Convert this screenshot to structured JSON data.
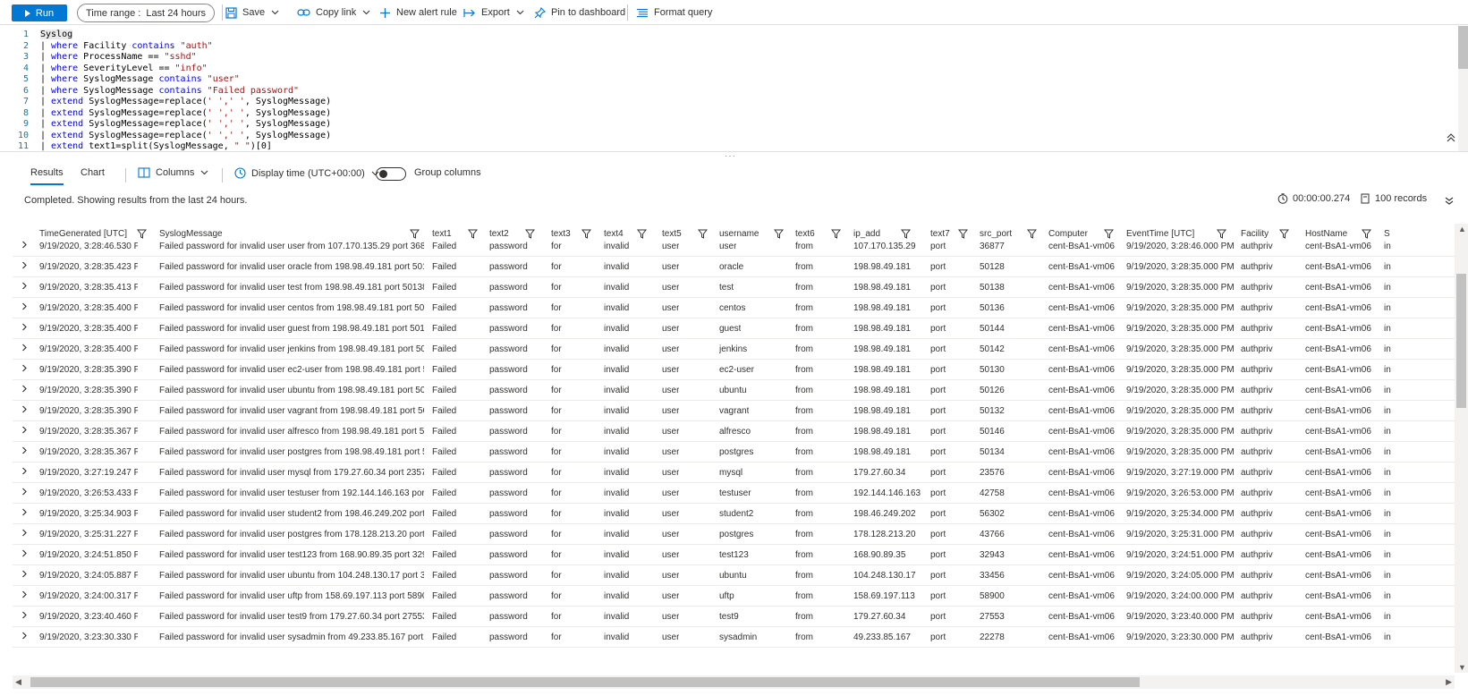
{
  "toolbar": {
    "run_label": "Run",
    "time_range_label": "Time range :",
    "time_range_value": "Last 24 hours",
    "save_label": "Save",
    "copy_link_label": "Copy link",
    "new_alert_label": "New alert rule",
    "export_label": "Export",
    "pin_label": "Pin to dashboard",
    "format_label": "Format query"
  },
  "editor": {
    "line_numbers": [
      "1",
      "2",
      "3",
      "4",
      "5",
      "6",
      "7",
      "8",
      "9",
      "10",
      "11"
    ]
  },
  "results_bar": {
    "tab_results": "Results",
    "tab_chart": "Chart",
    "columns_label": "Columns",
    "display_time_label": "Display time (UTC+00:00)",
    "group_columns_label": "Group columns"
  },
  "status": {
    "message": "Completed. Showing results from the last 24 hours.",
    "duration": "00:00:00.274",
    "records": "100 records"
  },
  "grid": {
    "headers": [
      "TimeGenerated [UTC]",
      "SyslogMessage",
      "text1",
      "text2",
      "text3",
      "text4",
      "text5",
      "username",
      "text6",
      "ip_add",
      "text7",
      "src_port",
      "Computer",
      "EventTime [UTC]",
      "Facility",
      "HostName",
      "S"
    ],
    "rows": [
      [
        "9/19/2020, 3:28:46.530 PM",
        "Failed password for invalid user user from 107.170.135.29 port 36877 s...",
        "Failed",
        "password",
        "for",
        "invalid",
        "user",
        "user",
        "from",
        "107.170.135.29",
        "port",
        "36877",
        "cent-BsA1-vm06",
        "9/19/2020, 3:28:46.000 PM",
        "authpriv",
        "cent-BsA1-vm06",
        "in"
      ],
      [
        "9/19/2020, 3:28:35.423 PM",
        "Failed password for invalid user oracle from 198.98.49.181 port 50128 ...",
        "Failed",
        "password",
        "for",
        "invalid",
        "user",
        "oracle",
        "from",
        "198.98.49.181",
        "port",
        "50128",
        "cent-BsA1-vm06",
        "9/19/2020, 3:28:35.000 PM",
        "authpriv",
        "cent-BsA1-vm06",
        "in"
      ],
      [
        "9/19/2020, 3:28:35.413 PM",
        "Failed password for invalid user test from 198.98.49.181 port 50138 ssh2",
        "Failed",
        "password",
        "for",
        "invalid",
        "user",
        "test",
        "from",
        "198.98.49.181",
        "port",
        "50138",
        "cent-BsA1-vm06",
        "9/19/2020, 3:28:35.000 PM",
        "authpriv",
        "cent-BsA1-vm06",
        "in"
      ],
      [
        "9/19/2020, 3:28:35.400 PM",
        "Failed password for invalid user centos from 198.98.49.181 port 50136...",
        "Failed",
        "password",
        "for",
        "invalid",
        "user",
        "centos",
        "from",
        "198.98.49.181",
        "port",
        "50136",
        "cent-BsA1-vm06",
        "9/19/2020, 3:28:35.000 PM",
        "authpriv",
        "cent-BsA1-vm06",
        "in"
      ],
      [
        "9/19/2020, 3:28:35.400 PM",
        "Failed password for invalid user guest from 198.98.49.181 port 50144 ...",
        "Failed",
        "password",
        "for",
        "invalid",
        "user",
        "guest",
        "from",
        "198.98.49.181",
        "port",
        "50144",
        "cent-BsA1-vm06",
        "9/19/2020, 3:28:35.000 PM",
        "authpriv",
        "cent-BsA1-vm06",
        "in"
      ],
      [
        "9/19/2020, 3:28:35.400 PM",
        "Failed password for invalid user jenkins from 198.98.49.181 port 50142...",
        "Failed",
        "password",
        "for",
        "invalid",
        "user",
        "jenkins",
        "from",
        "198.98.49.181",
        "port",
        "50142",
        "cent-BsA1-vm06",
        "9/19/2020, 3:28:35.000 PM",
        "authpriv",
        "cent-BsA1-vm06",
        "in"
      ],
      [
        "9/19/2020, 3:28:35.390 PM",
        "Failed password for invalid user ec2-user from 198.98.49.181 port 501...",
        "Failed",
        "password",
        "for",
        "invalid",
        "user",
        "ec2-user",
        "from",
        "198.98.49.181",
        "port",
        "50130",
        "cent-BsA1-vm06",
        "9/19/2020, 3:28:35.000 PM",
        "authpriv",
        "cent-BsA1-vm06",
        "in"
      ],
      [
        "9/19/2020, 3:28:35.390 PM",
        "Failed password for invalid user ubuntu from 198.98.49.181 port 5012...",
        "Failed",
        "password",
        "for",
        "invalid",
        "user",
        "ubuntu",
        "from",
        "198.98.49.181",
        "port",
        "50126",
        "cent-BsA1-vm06",
        "9/19/2020, 3:28:35.000 PM",
        "authpriv",
        "cent-BsA1-vm06",
        "in"
      ],
      [
        "9/19/2020, 3:28:35.390 PM",
        "Failed password for invalid user vagrant from 198.98.49.181 port 5013...",
        "Failed",
        "password",
        "for",
        "invalid",
        "user",
        "vagrant",
        "from",
        "198.98.49.181",
        "port",
        "50132",
        "cent-BsA1-vm06",
        "9/19/2020, 3:28:35.000 PM",
        "authpriv",
        "cent-BsA1-vm06",
        "in"
      ],
      [
        "9/19/2020, 3:28:35.367 PM",
        "Failed password for invalid user alfresco from 198.98.49.181 port 5014...",
        "Failed",
        "password",
        "for",
        "invalid",
        "user",
        "alfresco",
        "from",
        "198.98.49.181",
        "port",
        "50146",
        "cent-BsA1-vm06",
        "9/19/2020, 3:28:35.000 PM",
        "authpriv",
        "cent-BsA1-vm06",
        "in"
      ],
      [
        "9/19/2020, 3:28:35.367 PM",
        "Failed password for invalid user postgres from 198.98.49.181 port 501...",
        "Failed",
        "password",
        "for",
        "invalid",
        "user",
        "postgres",
        "from",
        "198.98.49.181",
        "port",
        "50134",
        "cent-BsA1-vm06",
        "9/19/2020, 3:28:35.000 PM",
        "authpriv",
        "cent-BsA1-vm06",
        "in"
      ],
      [
        "9/19/2020, 3:27:19.247 PM",
        "Failed password for invalid user mysql from 179.27.60.34 port 23576 s...",
        "Failed",
        "password",
        "for",
        "invalid",
        "user",
        "mysql",
        "from",
        "179.27.60.34",
        "port",
        "23576",
        "cent-BsA1-vm06",
        "9/19/2020, 3:27:19.000 PM",
        "authpriv",
        "cent-BsA1-vm06",
        "in"
      ],
      [
        "9/19/2020, 3:26:53.433 PM",
        "Failed password for invalid user testuser from 192.144.146.163 port 42...",
        "Failed",
        "password",
        "for",
        "invalid",
        "user",
        "testuser",
        "from",
        "192.144.146.163",
        "port",
        "42758",
        "cent-BsA1-vm06",
        "9/19/2020, 3:26:53.000 PM",
        "authpriv",
        "cent-BsA1-vm06",
        "in"
      ],
      [
        "9/19/2020, 3:25:34.903 PM",
        "Failed password for invalid user student2 from 198.46.249.202 port 56...",
        "Failed",
        "password",
        "for",
        "invalid",
        "user",
        "student2",
        "from",
        "198.46.249.202",
        "port",
        "56302",
        "cent-BsA1-vm06",
        "9/19/2020, 3:25:34.000 PM",
        "authpriv",
        "cent-BsA1-vm06",
        "in"
      ],
      [
        "9/19/2020, 3:25:31.227 PM",
        "Failed password for invalid user postgres from 178.128.213.20 port 43...",
        "Failed",
        "password",
        "for",
        "invalid",
        "user",
        "postgres",
        "from",
        "178.128.213.20",
        "port",
        "43766",
        "cent-BsA1-vm06",
        "9/19/2020, 3:25:31.000 PM",
        "authpriv",
        "cent-BsA1-vm06",
        "in"
      ],
      [
        "9/19/2020, 3:24:51.850 PM",
        "Failed password for invalid user test123 from 168.90.89.35 port 32943 ...",
        "Failed",
        "password",
        "for",
        "invalid",
        "user",
        "test123",
        "from",
        "168.90.89.35",
        "port",
        "32943",
        "cent-BsA1-vm06",
        "9/19/2020, 3:24:51.000 PM",
        "authpriv",
        "cent-BsA1-vm06",
        "in"
      ],
      [
        "9/19/2020, 3:24:05.887 PM",
        "Failed password for invalid user ubuntu from 104.248.130.17 port 334...",
        "Failed",
        "password",
        "for",
        "invalid",
        "user",
        "ubuntu",
        "from",
        "104.248.130.17",
        "port",
        "33456",
        "cent-BsA1-vm06",
        "9/19/2020, 3:24:05.000 PM",
        "authpriv",
        "cent-BsA1-vm06",
        "in"
      ],
      [
        "9/19/2020, 3:24:00.317 PM",
        "Failed password for invalid user uftp from 158.69.197.113 port 58900 s...",
        "Failed",
        "password",
        "for",
        "invalid",
        "user",
        "uftp",
        "from",
        "158.69.197.113",
        "port",
        "58900",
        "cent-BsA1-vm06",
        "9/19/2020, 3:24:00.000 PM",
        "authpriv",
        "cent-BsA1-vm06",
        "in"
      ],
      [
        "9/19/2020, 3:23:40.460 PM",
        "Failed password for invalid user test9 from 179.27.60.34 port 27553 ssh2",
        "Failed",
        "password",
        "for",
        "invalid",
        "user",
        "test9",
        "from",
        "179.27.60.34",
        "port",
        "27553",
        "cent-BsA1-vm06",
        "9/19/2020, 3:23:40.000 PM",
        "authpriv",
        "cent-BsA1-vm06",
        "in"
      ],
      [
        "9/19/2020, 3:23:30.330 PM",
        "Failed password for invalid user sysadmin from 49.233.85.167 port 22...",
        "Failed",
        "password",
        "for",
        "invalid",
        "user",
        "sysadmin",
        "from",
        "49.233.85.167",
        "port",
        "22278",
        "cent-BsA1-vm06",
        "9/19/2020, 3:23:30.000 PM",
        "authpriv",
        "cent-BsA1-vm06",
        "in"
      ]
    ]
  },
  "colors": {
    "accent": "#0078d4",
    "border": "#edebe9",
    "keyword": "#0000ff",
    "string": "#a31515",
    "line_number": "#237893"
  }
}
